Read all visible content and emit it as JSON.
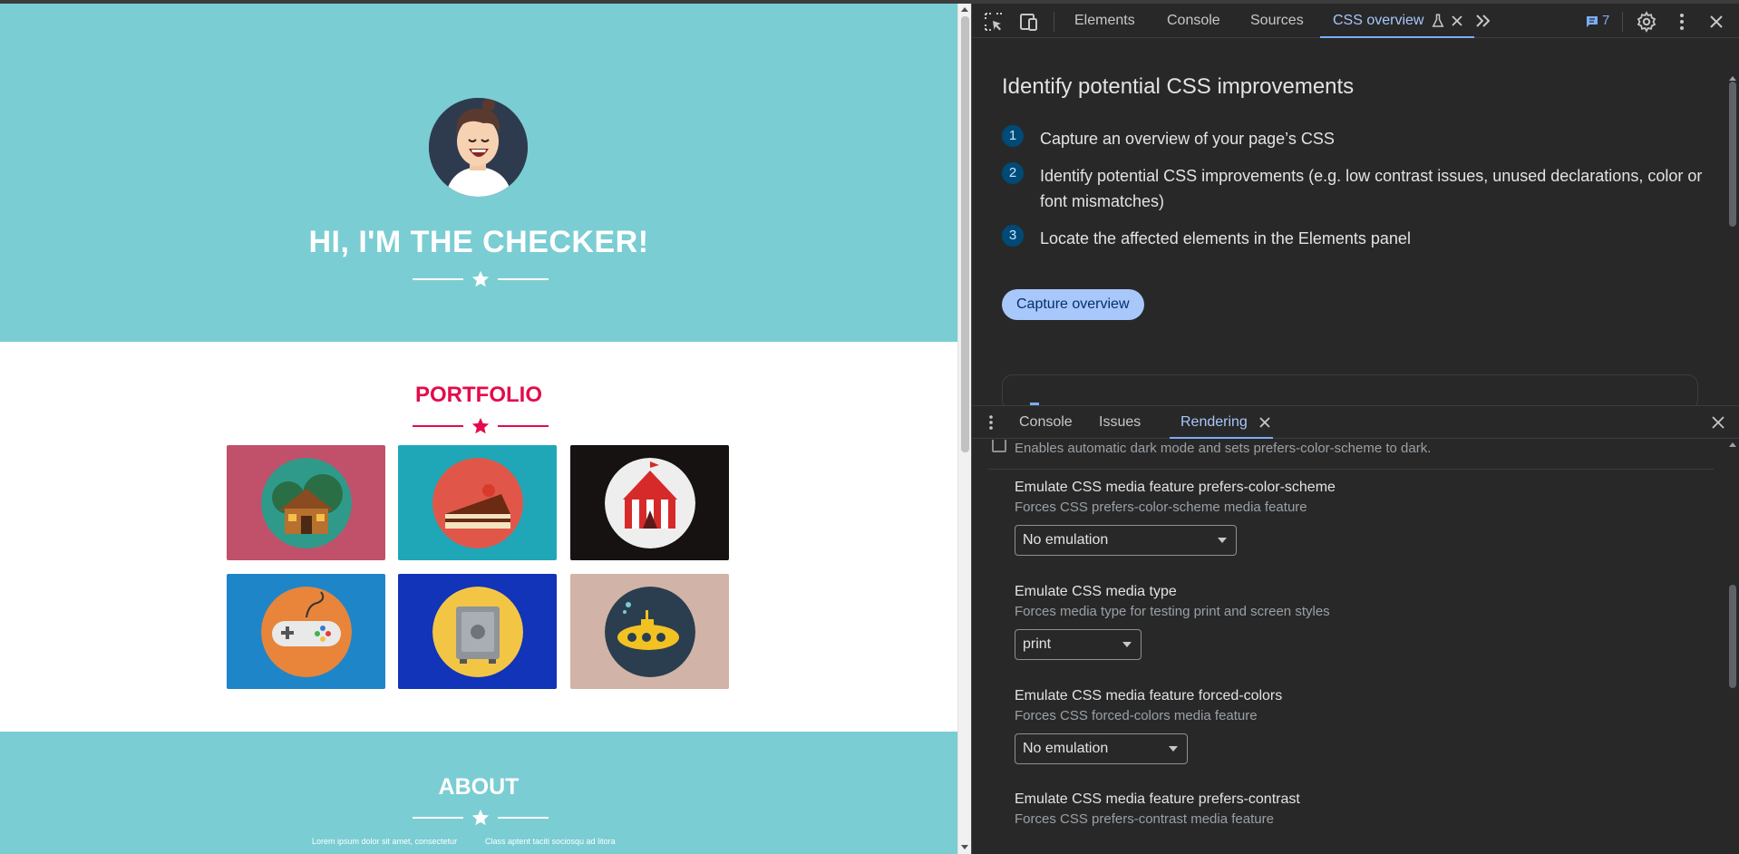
{
  "webpage": {
    "hero_title": "HI, I'M THE CHECKER!",
    "portfolio_title": "PORTFOLIO",
    "about_title": "ABOUT",
    "about_col1": "Lorem ipsum dolor sit amet, consectetur",
    "about_col2": "Class aptent taciti sociosqu ad litora",
    "colors": {
      "hero_bg": "#7acdd3",
      "accent": "#e30c4b",
      "tiles": [
        "#c1506a",
        "#1fa7b8",
        "#171212",
        "#1f85c9",
        "#1234b8",
        "#d1b4a7"
      ]
    }
  },
  "devtools": {
    "tabs": [
      {
        "label": "Elements"
      },
      {
        "label": "Console"
      },
      {
        "label": "Sources"
      },
      {
        "label": "CSS overview"
      }
    ],
    "issues_count": "7",
    "icons": [
      "inspect-element-icon",
      "device-toolbar-icon",
      "experiment-flask-icon",
      "close-icon",
      "more-tabs-icon",
      "issues-message-icon",
      "settings-gear-icon",
      "kebab-menu-icon"
    ],
    "css_overview": {
      "title": "Identify potential CSS improvements",
      "steps": [
        {
          "num": "1",
          "text": "Capture an overview of your page’s CSS"
        },
        {
          "num": "2",
          "text": "Identify potential CSS improvements (e.g. low contrast issues, unused declarations, color or font mismatches)"
        },
        {
          "num": "3",
          "text": "Locate the affected elements in the Elements panel"
        }
      ],
      "capture_button": "Capture overview"
    },
    "drawer": {
      "tabs": [
        {
          "label": "Console"
        },
        {
          "label": "Issues"
        },
        {
          "label": "Rendering"
        }
      ],
      "dark_mode_desc": "Enables automatic dark mode and sets prefers-color-scheme to dark.",
      "settings": [
        {
          "label": "Emulate CSS media feature prefers-color-scheme",
          "desc": "Forces CSS prefers-color-scheme media feature",
          "value": "No emulation"
        },
        {
          "label": "Emulate CSS media type",
          "desc": "Forces media type for testing print and screen styles",
          "value": "print"
        },
        {
          "label": "Emulate CSS media feature forced-colors",
          "desc": "Forces CSS forced-colors media feature",
          "value": "No emulation"
        },
        {
          "label": "Emulate CSS media feature prefers-contrast",
          "desc": "Forces CSS prefers-contrast media feature"
        }
      ]
    }
  }
}
